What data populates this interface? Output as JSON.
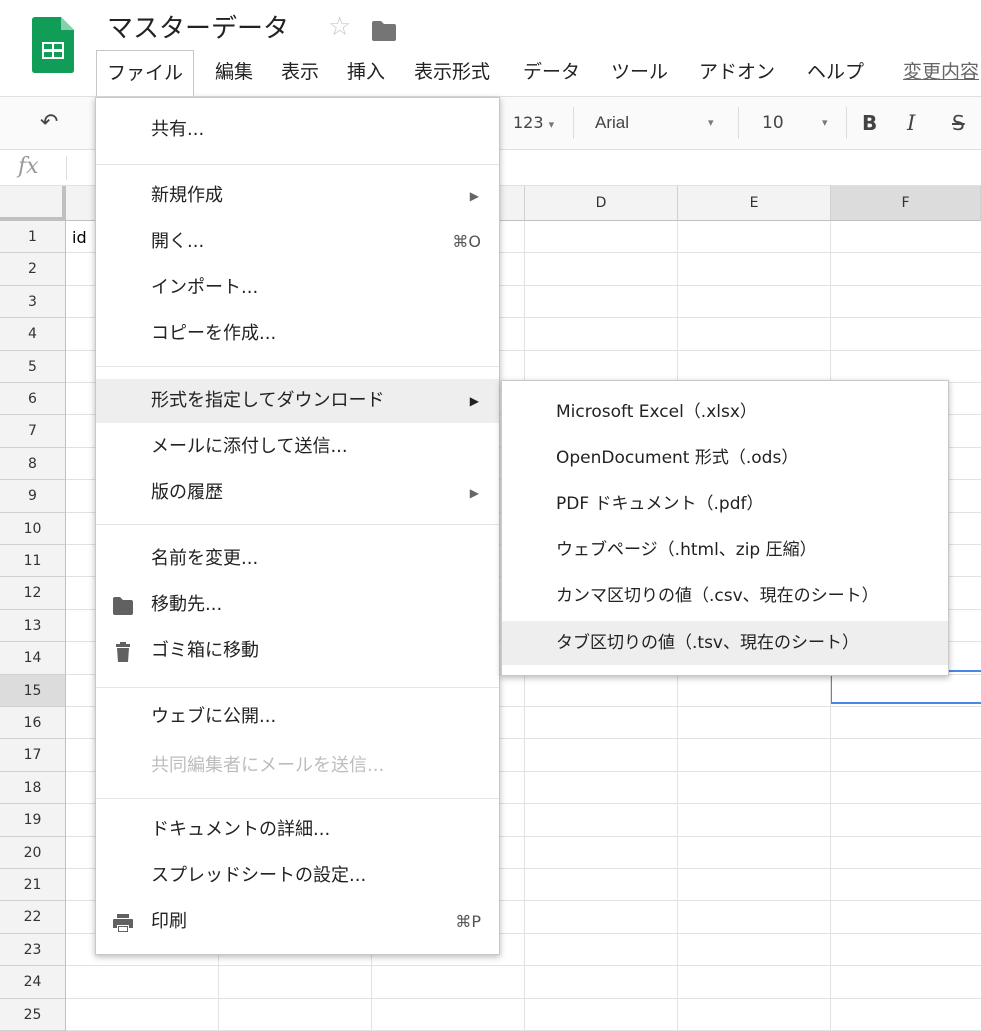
{
  "doc": {
    "title": "マスターデータ",
    "star": "☆"
  },
  "menubar": {
    "items": [
      "ファイル",
      "編集",
      "表示",
      "挿入",
      "表示形式",
      "データ",
      "ツール",
      "アドオン",
      "ヘルプ",
      "変更内容"
    ],
    "active_index": 0
  },
  "toolbar": {
    "undo_glyph": "↶",
    "number_format": "123",
    "font": "Arial",
    "font_size": "10",
    "bold": "B",
    "italic": "I",
    "strike": "S",
    "dropdown_glyph": "▾"
  },
  "formula_bar": {
    "fx": "fx"
  },
  "grid": {
    "columns": [
      "D",
      "E",
      "F"
    ],
    "selected_column": "F",
    "rows": [
      "1",
      "2",
      "3",
      "4",
      "5",
      "6",
      "7",
      "8",
      "9",
      "10",
      "11",
      "12",
      "13",
      "14",
      "15",
      "16",
      "17",
      "18",
      "19",
      "20",
      "21",
      "22",
      "23",
      "24",
      "25"
    ],
    "selected_row": "15",
    "cell_a1": "id"
  },
  "file_menu": {
    "items": [
      {
        "label": "共有...",
        "shortcut": "",
        "submenu": false
      },
      {
        "label": "新規作成",
        "shortcut": "",
        "submenu": true
      },
      {
        "label": "開く...",
        "shortcut": "⌘O",
        "submenu": false
      },
      {
        "label": "インポート...",
        "shortcut": "",
        "submenu": false
      },
      {
        "label": "コピーを作成...",
        "shortcut": "",
        "submenu": false
      },
      {
        "label": "形式を指定してダウンロード",
        "shortcut": "",
        "submenu": true,
        "highlighted": true
      },
      {
        "label": "メールに添付して送信...",
        "shortcut": "",
        "submenu": false
      },
      {
        "label": "版の履歴",
        "shortcut": "",
        "submenu": true
      },
      {
        "label": "名前を変更...",
        "shortcut": "",
        "submenu": false
      },
      {
        "label": "移動先...",
        "shortcut": "",
        "submenu": false,
        "icon": "folder-icon"
      },
      {
        "label": "ゴミ箱に移動",
        "shortcut": "",
        "submenu": false,
        "icon": "trash-icon"
      },
      {
        "label": "ウェブに公開...",
        "shortcut": "",
        "submenu": false
      },
      {
        "label": "共同編集者にメールを送信...",
        "shortcut": "",
        "submenu": false,
        "disabled": true
      },
      {
        "label": "ドキュメントの詳細...",
        "shortcut": "",
        "submenu": false
      },
      {
        "label": "スプレッドシートの設定...",
        "shortcut": "",
        "submenu": false
      },
      {
        "label": "印刷",
        "shortcut": "⌘P",
        "submenu": false,
        "icon": "printer-icon"
      }
    ],
    "submenu_arrow": "▶"
  },
  "download_submenu": {
    "items": [
      "Microsoft Excel（.xlsx）",
      "OpenDocument 形式（.ods）",
      "PDF ドキュメント（.pdf）",
      "ウェブページ（.html、zip 圧縮）",
      "カンマ区切りの値（.csv、現在のシート）",
      "タブ区切りの値（.tsv、現在のシート）"
    ],
    "highlighted_index": 5
  },
  "colors": {
    "sheets_green": "#0f9d58",
    "selection_blue": "#4a86e8",
    "menu_hover": "#eeeeee"
  }
}
